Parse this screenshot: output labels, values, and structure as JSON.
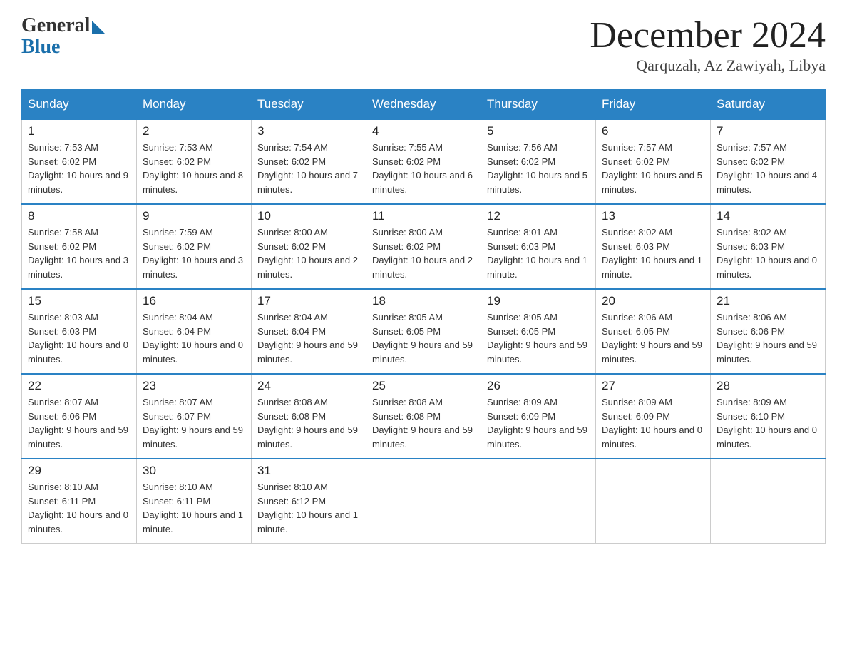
{
  "header": {
    "logo_general": "General",
    "logo_blue": "Blue",
    "month_title": "December 2024",
    "subtitle": "Qarquzah, Az Zawiyah, Libya"
  },
  "days_of_week": [
    "Sunday",
    "Monday",
    "Tuesday",
    "Wednesday",
    "Thursday",
    "Friday",
    "Saturday"
  ],
  "weeks": [
    [
      {
        "day": "1",
        "sunrise": "7:53 AM",
        "sunset": "6:02 PM",
        "daylight": "10 hours and 9 minutes."
      },
      {
        "day": "2",
        "sunrise": "7:53 AM",
        "sunset": "6:02 PM",
        "daylight": "10 hours and 8 minutes."
      },
      {
        "day": "3",
        "sunrise": "7:54 AM",
        "sunset": "6:02 PM",
        "daylight": "10 hours and 7 minutes."
      },
      {
        "day": "4",
        "sunrise": "7:55 AM",
        "sunset": "6:02 PM",
        "daylight": "10 hours and 6 minutes."
      },
      {
        "day": "5",
        "sunrise": "7:56 AM",
        "sunset": "6:02 PM",
        "daylight": "10 hours and 5 minutes."
      },
      {
        "day": "6",
        "sunrise": "7:57 AM",
        "sunset": "6:02 PM",
        "daylight": "10 hours and 5 minutes."
      },
      {
        "day": "7",
        "sunrise": "7:57 AM",
        "sunset": "6:02 PM",
        "daylight": "10 hours and 4 minutes."
      }
    ],
    [
      {
        "day": "8",
        "sunrise": "7:58 AM",
        "sunset": "6:02 PM",
        "daylight": "10 hours and 3 minutes."
      },
      {
        "day": "9",
        "sunrise": "7:59 AM",
        "sunset": "6:02 PM",
        "daylight": "10 hours and 3 minutes."
      },
      {
        "day": "10",
        "sunrise": "8:00 AM",
        "sunset": "6:02 PM",
        "daylight": "10 hours and 2 minutes."
      },
      {
        "day": "11",
        "sunrise": "8:00 AM",
        "sunset": "6:02 PM",
        "daylight": "10 hours and 2 minutes."
      },
      {
        "day": "12",
        "sunrise": "8:01 AM",
        "sunset": "6:03 PM",
        "daylight": "10 hours and 1 minute."
      },
      {
        "day": "13",
        "sunrise": "8:02 AM",
        "sunset": "6:03 PM",
        "daylight": "10 hours and 1 minute."
      },
      {
        "day": "14",
        "sunrise": "8:02 AM",
        "sunset": "6:03 PM",
        "daylight": "10 hours and 0 minutes."
      }
    ],
    [
      {
        "day": "15",
        "sunrise": "8:03 AM",
        "sunset": "6:03 PM",
        "daylight": "10 hours and 0 minutes."
      },
      {
        "day": "16",
        "sunrise": "8:04 AM",
        "sunset": "6:04 PM",
        "daylight": "10 hours and 0 minutes."
      },
      {
        "day": "17",
        "sunrise": "8:04 AM",
        "sunset": "6:04 PM",
        "daylight": "9 hours and 59 minutes."
      },
      {
        "day": "18",
        "sunrise": "8:05 AM",
        "sunset": "6:05 PM",
        "daylight": "9 hours and 59 minutes."
      },
      {
        "day": "19",
        "sunrise": "8:05 AM",
        "sunset": "6:05 PM",
        "daylight": "9 hours and 59 minutes."
      },
      {
        "day": "20",
        "sunrise": "8:06 AM",
        "sunset": "6:05 PM",
        "daylight": "9 hours and 59 minutes."
      },
      {
        "day": "21",
        "sunrise": "8:06 AM",
        "sunset": "6:06 PM",
        "daylight": "9 hours and 59 minutes."
      }
    ],
    [
      {
        "day": "22",
        "sunrise": "8:07 AM",
        "sunset": "6:06 PM",
        "daylight": "9 hours and 59 minutes."
      },
      {
        "day": "23",
        "sunrise": "8:07 AM",
        "sunset": "6:07 PM",
        "daylight": "9 hours and 59 minutes."
      },
      {
        "day": "24",
        "sunrise": "8:08 AM",
        "sunset": "6:08 PM",
        "daylight": "9 hours and 59 minutes."
      },
      {
        "day": "25",
        "sunrise": "8:08 AM",
        "sunset": "6:08 PM",
        "daylight": "9 hours and 59 minutes."
      },
      {
        "day": "26",
        "sunrise": "8:09 AM",
        "sunset": "6:09 PM",
        "daylight": "9 hours and 59 minutes."
      },
      {
        "day": "27",
        "sunrise": "8:09 AM",
        "sunset": "6:09 PM",
        "daylight": "10 hours and 0 minutes."
      },
      {
        "day": "28",
        "sunrise": "8:09 AM",
        "sunset": "6:10 PM",
        "daylight": "10 hours and 0 minutes."
      }
    ],
    [
      {
        "day": "29",
        "sunrise": "8:10 AM",
        "sunset": "6:11 PM",
        "daylight": "10 hours and 0 minutes."
      },
      {
        "day": "30",
        "sunrise": "8:10 AM",
        "sunset": "6:11 PM",
        "daylight": "10 hours and 1 minute."
      },
      {
        "day": "31",
        "sunrise": "8:10 AM",
        "sunset": "6:12 PM",
        "daylight": "10 hours and 1 minute."
      },
      null,
      null,
      null,
      null
    ]
  ]
}
